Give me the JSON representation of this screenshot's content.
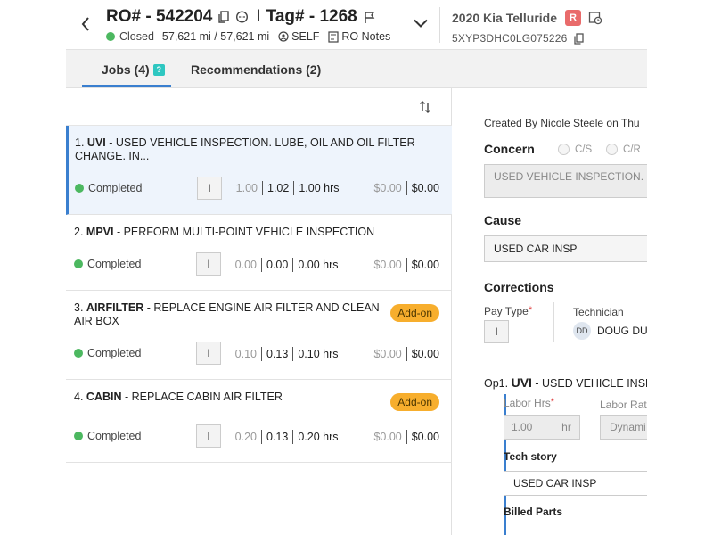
{
  "header": {
    "ro_label": "RO# - 542204",
    "tag_label": "Tag# - 1268",
    "separator": "I",
    "status": "Closed",
    "mileage": "57,621 mi / 57,621 mi",
    "self_label": "SELF",
    "ro_notes_label": "RO Notes",
    "vehicle": "2020 Kia Telluride",
    "vehicle_badge": "R",
    "vin": "5XYP3DHC0LG075226",
    "colors": {
      "status_green": "#4cb860",
      "badge_red": "#e96b6b",
      "accent_blue": "#3a7fcf"
    }
  },
  "tabs": {
    "jobs": "Jobs (4)",
    "jobs_badge": "?",
    "recommendations": "Recommendations (2)"
  },
  "jobs": [
    {
      "index": "1.",
      "code": "UVI",
      "desc": " - USED VEHICLE INSPECTION. LUBE, OIL AND OIL FILTER CHANGE. IN...",
      "status": "Completed",
      "pay": "I",
      "sold_hrs": "1.00",
      "actual_hrs": "1.02",
      "billed_hrs": "1.00 hrs",
      "cost": "$0.00",
      "price": "$0.00",
      "addon": ""
    },
    {
      "index": "2.",
      "code": "MPVI",
      "desc": " - PERFORM MULTI-POINT VEHICLE INSPECTION",
      "status": "Completed",
      "pay": "I",
      "sold_hrs": "0.00",
      "actual_hrs": "0.00",
      "billed_hrs": "0.00 hrs",
      "cost": "$0.00",
      "price": "$0.00",
      "addon": ""
    },
    {
      "index": "3.",
      "code": "AIRFILTER",
      "desc": " - REPLACE ENGINE AIR FILTER AND CLEAN AIR BOX",
      "status": "Completed",
      "pay": "I",
      "sold_hrs": "0.10",
      "actual_hrs": "0.13",
      "billed_hrs": "0.10 hrs",
      "cost": "$0.00",
      "price": "$0.00",
      "addon": "Add-on"
    },
    {
      "index": "4.",
      "code": "CABIN",
      "desc": " - REPLACE CABIN AIR FILTER",
      "status": "Completed",
      "pay": "I",
      "sold_hrs": "0.20",
      "actual_hrs": "0.13",
      "billed_hrs": "0.20 hrs",
      "cost": "$0.00",
      "price": "$0.00",
      "addon": "Add-on"
    }
  ],
  "detail": {
    "created_by": "Created By Nicole Steele on Thu",
    "concern_label": "Concern",
    "cs_label": "C/S",
    "cr_label": "C/R",
    "concern_value": "USED VEHICLE INSPECTION. LUBE",
    "cause_label": "Cause",
    "cause_value": "USED CAR INSP",
    "corrections_label": "Corrections",
    "pay_type_label": "Pay Type",
    "required_mark": "*",
    "pay_type_value": "I",
    "technician_label": "Technician",
    "tech_initials": "DD",
    "tech_name": "DOUG DU",
    "op_prefix": "Op1. ",
    "op_code": "UVI",
    "op_desc": " - USED VEHICLE INSP",
    "labor_hrs_label": "Labor Hrs",
    "labor_hrs_value": "1.00",
    "labor_hrs_unit": "hr",
    "labor_rate_label": "Labor Rat",
    "labor_rate_value": "Dynami",
    "tech_story_label": "Tech story",
    "tech_story_value": "USED CAR INSP",
    "billed_parts_label": "Billed Parts"
  }
}
